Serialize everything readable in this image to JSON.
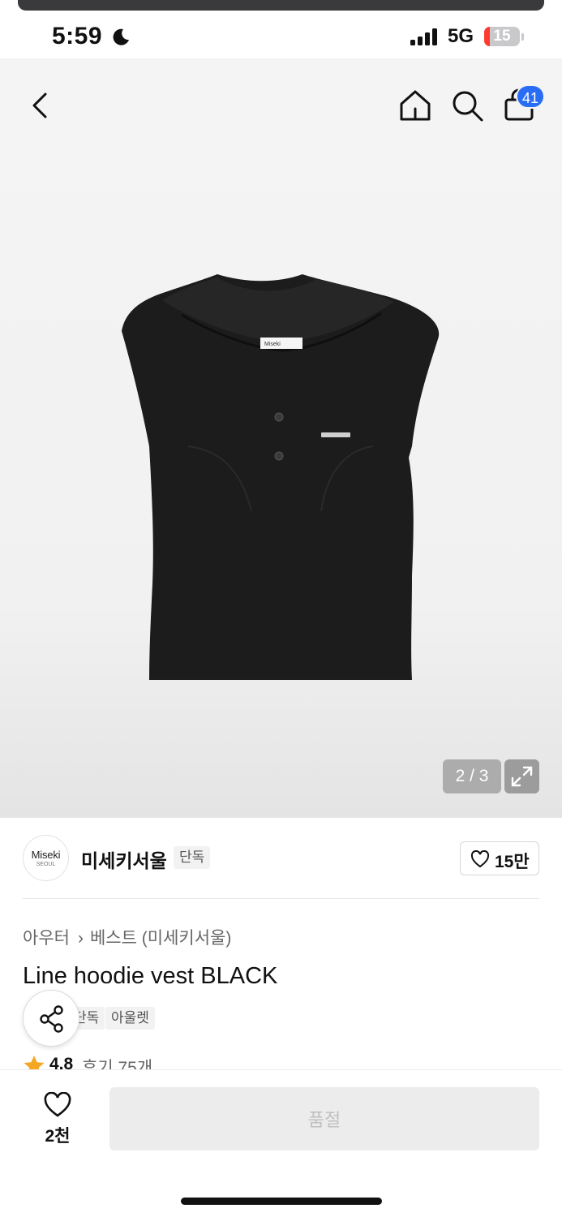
{
  "status_bar": {
    "time": "5:59",
    "network": "5G",
    "battery": "15",
    "battery_level": 0.15
  },
  "header": {
    "cart_count": "41"
  },
  "gallery": {
    "pager": "2 / 3",
    "product_logo_label": "Miseki"
  },
  "brand": {
    "logo_text": "Miseki",
    "logo_subtext": "SEOUL",
    "name": "미세키서울",
    "tag": "단독",
    "likes": "15만"
  },
  "breadcrumb": {
    "category": "아우터",
    "subcategory": "베스트 (미세키서울)"
  },
  "product": {
    "title": "Line hoodie vest BLACK",
    "tags": [
      "단독",
      "아울렛"
    ]
  },
  "rating": {
    "value": "4.8",
    "reviews": "후기 75개"
  },
  "bottom_bar": {
    "wish_count": "2천",
    "buy_label": "품절"
  },
  "colors": {
    "accent": "#2a6df5",
    "star": "#f5a623",
    "battery_low": "#ff3b30"
  },
  "icons": [
    "moon-icon",
    "signal-icon",
    "back-icon",
    "home-icon",
    "search-icon",
    "cart-icon",
    "expand-icon",
    "heart-icon",
    "star-icon",
    "share-icon"
  ]
}
